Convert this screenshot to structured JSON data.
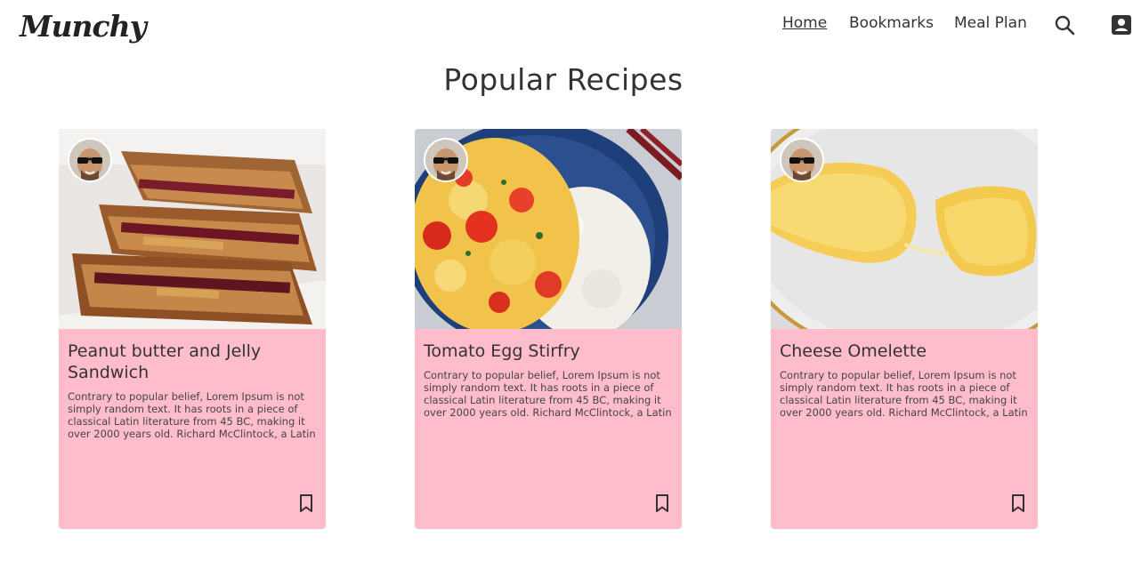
{
  "header": {
    "logo": "Munchy",
    "nav": [
      {
        "label": "Home",
        "active": true
      },
      {
        "label": "Bookmarks",
        "active": false
      },
      {
        "label": "Meal Plan",
        "active": false
      }
    ],
    "icons": [
      "search-icon",
      "account-icon"
    ]
  },
  "main": {
    "title": "Popular Recipes",
    "cards": [
      {
        "title": "Peanut butter and Jelly Sandwich",
        "description": "Contrary to popular belief, Lorem Ipsum is not simply random text. It has roots in a piece of classical Latin literature from 45 BC, making it over 2000 years old. Richard McClintock, a Latin",
        "image": "sandwich-photo"
      },
      {
        "title": "Tomato Egg Stirfry",
        "description": "Contrary to popular belief, Lorem Ipsum is not simply random text. It has roots in a piece of classical Latin literature from 45 BC, making it over 2000 years old. Richard McClintock, a Latin",
        "image": "stirfry-photo"
      },
      {
        "title": "Cheese Omelette",
        "description": "Contrary to popular belief, Lorem Ipsum is not simply random text. It has roots in a piece of classical Latin literature from 45 BC, making it over 2000 years old. Richard McClintock, a Latin",
        "image": "omelette-photo"
      }
    ]
  },
  "colors": {
    "card_background": "#ffbccb",
    "text": "#333333"
  }
}
